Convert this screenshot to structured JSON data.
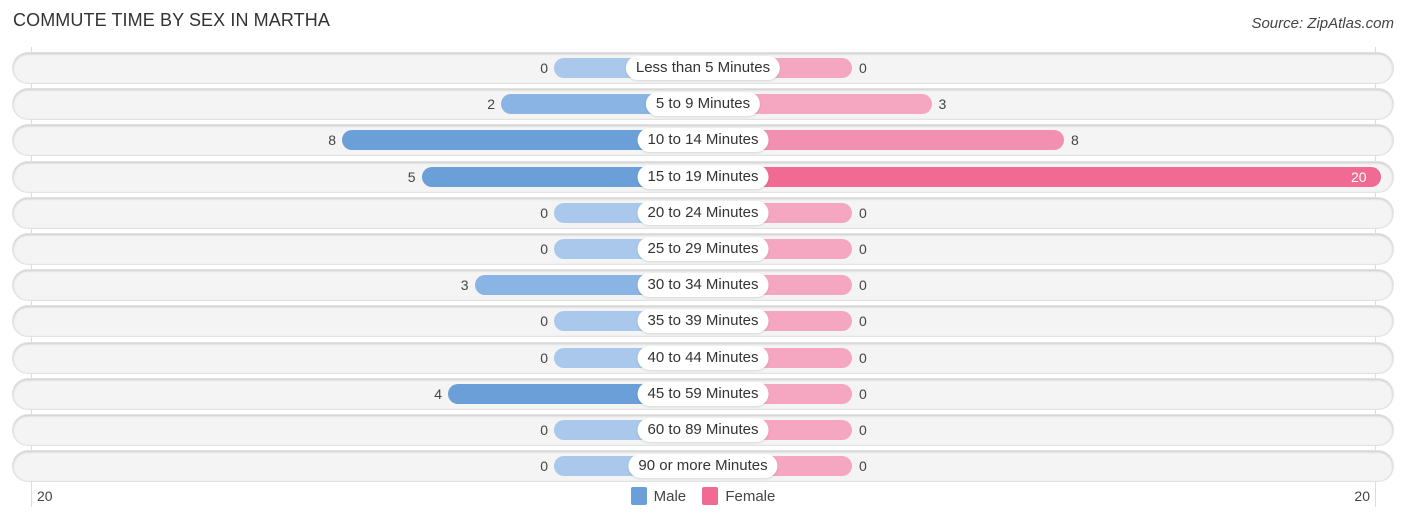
{
  "header": {
    "title": "COMMUTE TIME BY SEX IN MARTHA",
    "source": "Source: ZipAtlas.com"
  },
  "colors": {
    "male": "#6a9fd8",
    "male_light": "#a9c8ec",
    "female": "#f06a94",
    "female_light": "#f5a6c0"
  },
  "chart_data": {
    "type": "bar",
    "orientation": "horizontal-diverging",
    "title": "COMMUTE TIME BY SEX IN MARTHA",
    "categories": [
      "Less than 5 Minutes",
      "5 to 9 Minutes",
      "10 to 14 Minutes",
      "15 to 19 Minutes",
      "20 to 24 Minutes",
      "25 to 29 Minutes",
      "30 to 34 Minutes",
      "35 to 39 Minutes",
      "40 to 44 Minutes",
      "45 to 59 Minutes",
      "60 to 89 Minutes",
      "90 or more Minutes"
    ],
    "series": [
      {
        "name": "Male",
        "values": [
          0,
          2,
          8,
          5,
          0,
          0,
          3,
          0,
          0,
          4,
          0,
          0
        ]
      },
      {
        "name": "Female",
        "values": [
          0,
          3,
          8,
          20,
          0,
          0,
          0,
          0,
          0,
          0,
          0,
          0
        ]
      }
    ],
    "axis": {
      "left_tick": "20",
      "right_tick": "20",
      "max": 20
    },
    "legend": {
      "position": "bottom-center",
      "entries": [
        "Male",
        "Female"
      ]
    }
  }
}
